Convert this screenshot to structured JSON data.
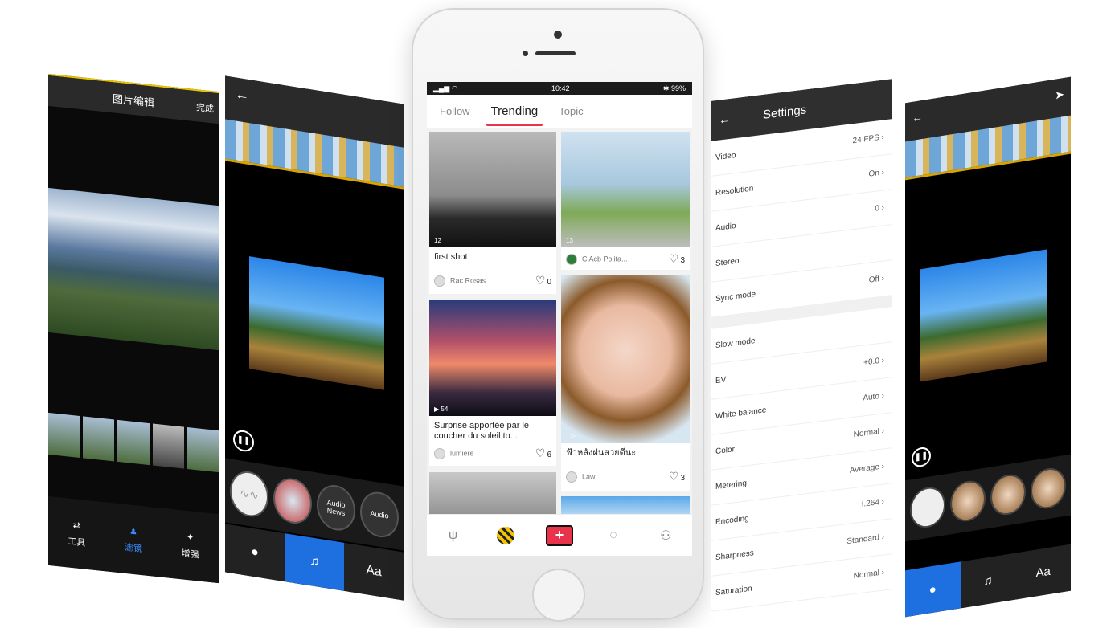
{
  "editor_screen": {
    "title": "图片编辑",
    "corner": "完成",
    "nav": [
      {
        "label": "工具"
      },
      {
        "label": "滤镜"
      },
      {
        "label": "增强"
      }
    ]
  },
  "video_screen": {
    "bottom_tabs": [
      "Aa"
    ],
    "tracks": [
      "Audio News",
      "Audio"
    ]
  },
  "main_app": {
    "status": {
      "time": "10:42",
      "battery": "99%"
    },
    "tabs": [
      "Follow",
      "Trending",
      "Topic"
    ],
    "active_tab": "Trending",
    "posts": [
      {
        "title": "first shot",
        "user": "Rac Rosas",
        "likes": "0",
        "views": "12"
      },
      {
        "title": "",
        "user": "C Acb Polita...",
        "likes": "3",
        "views": "13"
      },
      {
        "title": "Surprise apportée par le coucher du soleil to...",
        "user": "lumière",
        "likes": "6",
        "views": "54"
      },
      {
        "title": "ฟ้าหลังฝนสวยดีนะ",
        "user": "Law",
        "likes": "3",
        "views": "133"
      }
    ],
    "accent": "#e8334a"
  },
  "settings_screen": {
    "title": "Settings",
    "rows": [
      {
        "label": "Video",
        "value": "24 FPS"
      },
      {
        "label": "Resolution",
        "value": "On"
      },
      {
        "label": "Audio",
        "value": "0"
      },
      {
        "label": "Stereo",
        "value": ""
      },
      {
        "label": "Sync mode",
        "value": "Off"
      },
      {
        "label": "Slow mode",
        "value": ""
      },
      {
        "label": "EV",
        "value": "+0.0"
      },
      {
        "label": "White balance",
        "value": "Auto"
      },
      {
        "label": "Color",
        "value": "Normal"
      },
      {
        "label": "Metering",
        "value": "Average"
      },
      {
        "label": "Encoding",
        "value": "H.264"
      },
      {
        "label": "Sharpness",
        "value": "Standard"
      },
      {
        "label": "Saturation",
        "value": "Normal"
      }
    ]
  },
  "right_screen": {
    "bottom_tabs": [
      "Aa"
    ]
  }
}
